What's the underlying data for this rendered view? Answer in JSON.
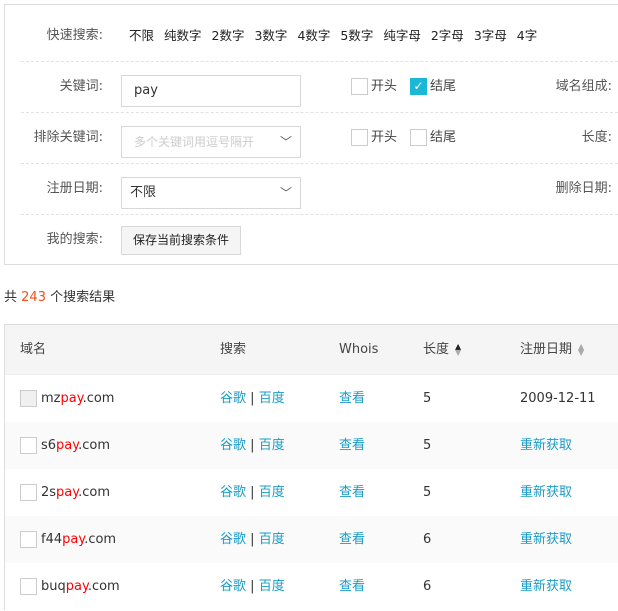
{
  "filters": {
    "quick_label": "快速搜索:",
    "quick_options": [
      "不限",
      "纯数字",
      "2数字",
      "3数字",
      "4数字",
      "5数字",
      "纯字母",
      "2字母",
      "3字母",
      "4字"
    ],
    "keyword_label": "关键词:",
    "keyword_value": "pay",
    "start_label": "开头",
    "end_label": "结尾",
    "keyword_start_checked": false,
    "keyword_end_checked": true,
    "composition_label": "域名组成:",
    "exclude_label": "排除关键词:",
    "exclude_placeholder": "多个关键词用逗号隔开",
    "exclude_start_checked": false,
    "exclude_end_checked": false,
    "length_label": "长度:",
    "reg_date_label": "注册日期:",
    "reg_date_value": "不限",
    "delete_date_label": "删除日期:",
    "my_search_label": "我的搜索:",
    "save_button": "保存当前搜索条件"
  },
  "results": {
    "prefix": "共",
    "count": "243",
    "suffix": "个搜索结果"
  },
  "table": {
    "headers": [
      "域名",
      "搜索",
      "Whois",
      "长度",
      "注册日期"
    ],
    "sort": {
      "length": "ascending",
      "reg_date": "none"
    },
    "search_google": "谷歌",
    "search_sep": "|",
    "search_baidu": "百度",
    "whois_link": "查看",
    "rows": [
      {
        "pre": "mz",
        "kw": "pay",
        "post": ".com",
        "length": "5",
        "date": "2009-12-11",
        "date_is_link": false,
        "disabled": true
      },
      {
        "pre": "s6",
        "kw": "pay",
        "post": ".com",
        "length": "5",
        "date": "重新获取",
        "date_is_link": true,
        "disabled": false
      },
      {
        "pre": "2s",
        "kw": "pay",
        "post": ".com",
        "length": "5",
        "date": "重新获取",
        "date_is_link": true,
        "disabled": false
      },
      {
        "pre": "f44",
        "kw": "pay",
        "post": ".com",
        "length": "6",
        "date": "重新获取",
        "date_is_link": true,
        "disabled": false
      },
      {
        "pre": "buq",
        "kw": "pay",
        "post": ".com",
        "length": "6",
        "date": "重新获取",
        "date_is_link": true,
        "disabled": false
      }
    ]
  },
  "colors": {
    "accent": "#1bb7d6",
    "link": "#1a9cc8",
    "highlight": "#ff0000",
    "count": "#f0501e"
  }
}
